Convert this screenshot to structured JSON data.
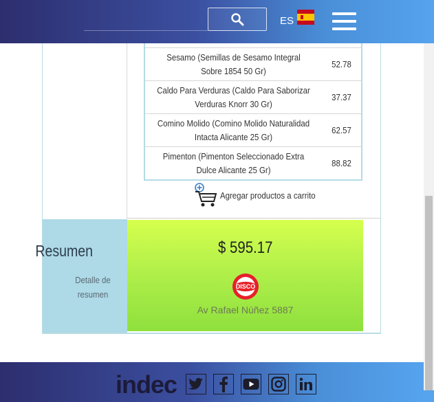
{
  "header": {
    "search_icon": "search-icon",
    "language": "ES",
    "flag": "spain-flag",
    "menu_icon": "hamburger-menu-icon"
  },
  "products": [
    {
      "name": "Sesamo (Semillas de Sesamo Integral Sobre 1854 50 Gr)",
      "price": "52.78"
    },
    {
      "name": "Caldo Para Verduras (Caldo Para Saborizar Verduras Knorr 30 Gr)",
      "price": "37.37"
    },
    {
      "name": "Comino Molido (Comino Molido Naturalidad Intacta Alicante 25 Gr)",
      "price": "62.57"
    },
    {
      "name": "Pimenton (Pimenton Seleccionado Extra Dulce Alicante 25 Gr)",
      "price": "88.82"
    }
  ],
  "add_to_cart": {
    "label": "Agregar productos a carrito",
    "icon": "add-cart-icon"
  },
  "summary": {
    "title": "Resumen",
    "subtitle": "Detalle de resumen",
    "total": "$ 595.17",
    "store_logo_text": "DISCO",
    "address": "Av Rafael Núñez 5887"
  },
  "footer": {
    "logo": "indec",
    "social": [
      "twitter-icon",
      "facebook-icon",
      "youtube-icon",
      "instagram-icon",
      "linkedin-icon"
    ]
  },
  "colors": {
    "header_start": "#2d2e6e",
    "header_end": "#56a3ee",
    "summary_side": "#aed9e6",
    "total_green": "#b2f04a"
  }
}
